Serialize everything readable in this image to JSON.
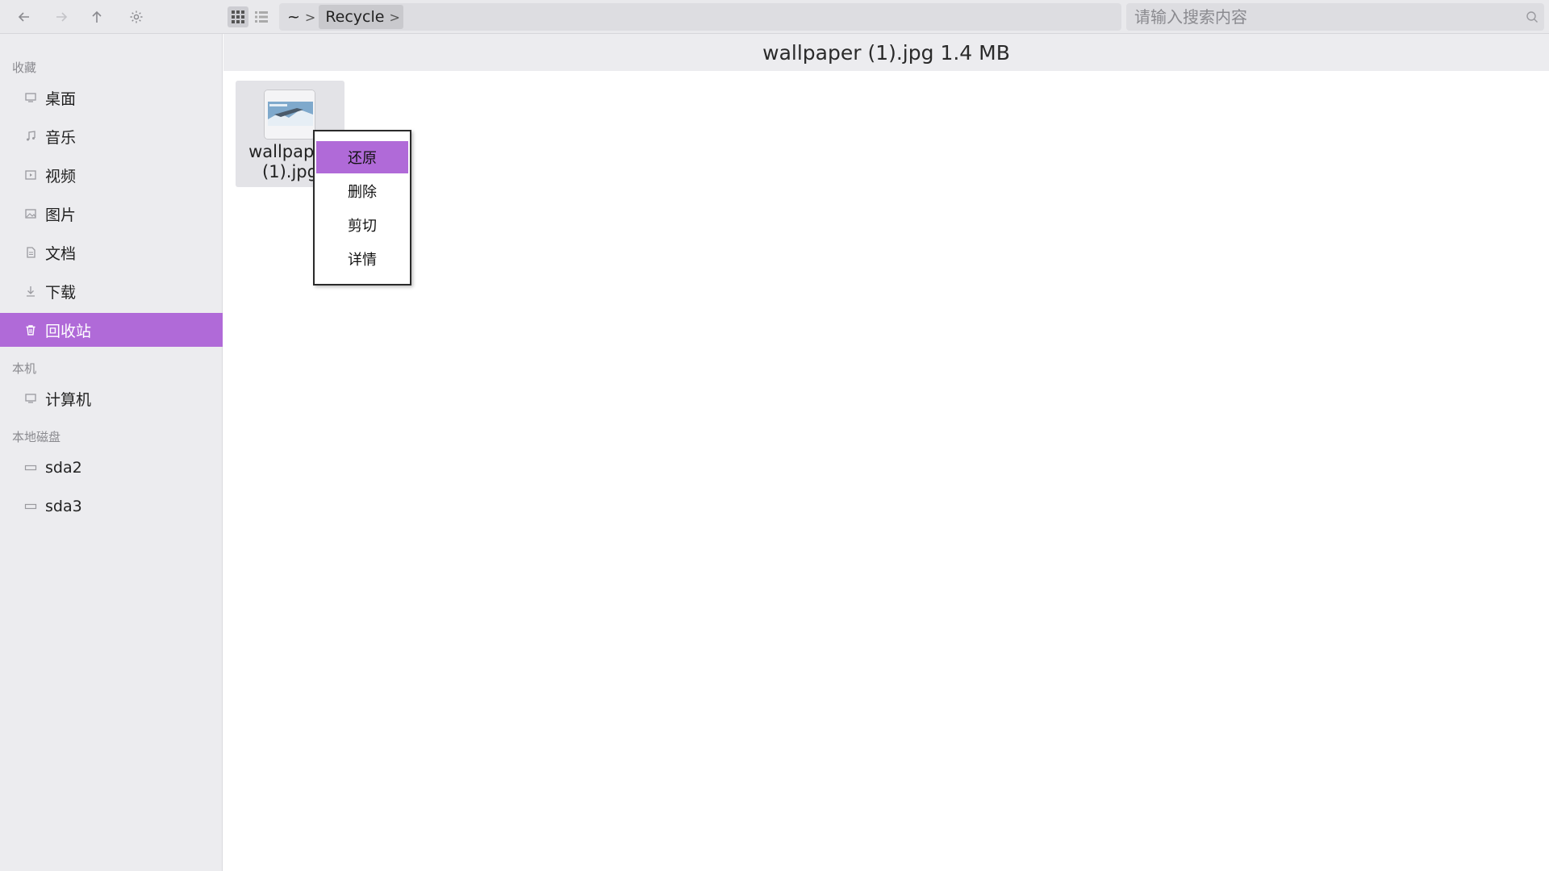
{
  "toolbar": {
    "back_icon": "arrow-left-icon",
    "forward_icon": "arrow-right-icon",
    "up_icon": "arrow-up-icon",
    "settings_icon": "gear-icon",
    "grid_view_icon": "grid-icon",
    "list_view_icon": "list-icon"
  },
  "breadcrumb": {
    "items": [
      {
        "label": "~"
      },
      {
        "label": "Recycle"
      }
    ]
  },
  "search": {
    "placeholder": "请输入搜索内容",
    "value": ""
  },
  "sidebar": {
    "favorites_title": "收藏",
    "favorites": [
      {
        "label": "桌面",
        "icon": "desktop-icon"
      },
      {
        "label": "音乐",
        "icon": "music-icon"
      },
      {
        "label": "视频",
        "icon": "video-icon"
      },
      {
        "label": "图片",
        "icon": "image-icon"
      },
      {
        "label": "文档",
        "icon": "document-icon"
      },
      {
        "label": "下载",
        "icon": "download-icon"
      },
      {
        "label": "回收站",
        "icon": "trash-icon",
        "selected": true
      }
    ],
    "computer_title": "本机",
    "computer": [
      {
        "label": "计算机",
        "icon": "computer-icon"
      }
    ],
    "disks_title": "本地磁盘",
    "disks": [
      {
        "label": "sda2",
        "icon": "drive-icon"
      },
      {
        "label": "sda3",
        "icon": "drive-icon"
      }
    ]
  },
  "main": {
    "header": "wallpaper (1).jpg 1.4 MB",
    "files": [
      {
        "name_line1": "wallpaper",
        "name_line2": "(1).jpg"
      }
    ]
  },
  "context_menu": {
    "items": [
      {
        "label": "还原"
      },
      {
        "label": "删除"
      },
      {
        "label": "剪切"
      },
      {
        "label": "详情"
      }
    ]
  },
  "colors": {
    "accent": "#b06ad8",
    "sidebar_bg": "#ececef",
    "toolbar_bg": "#e9e9ec"
  }
}
